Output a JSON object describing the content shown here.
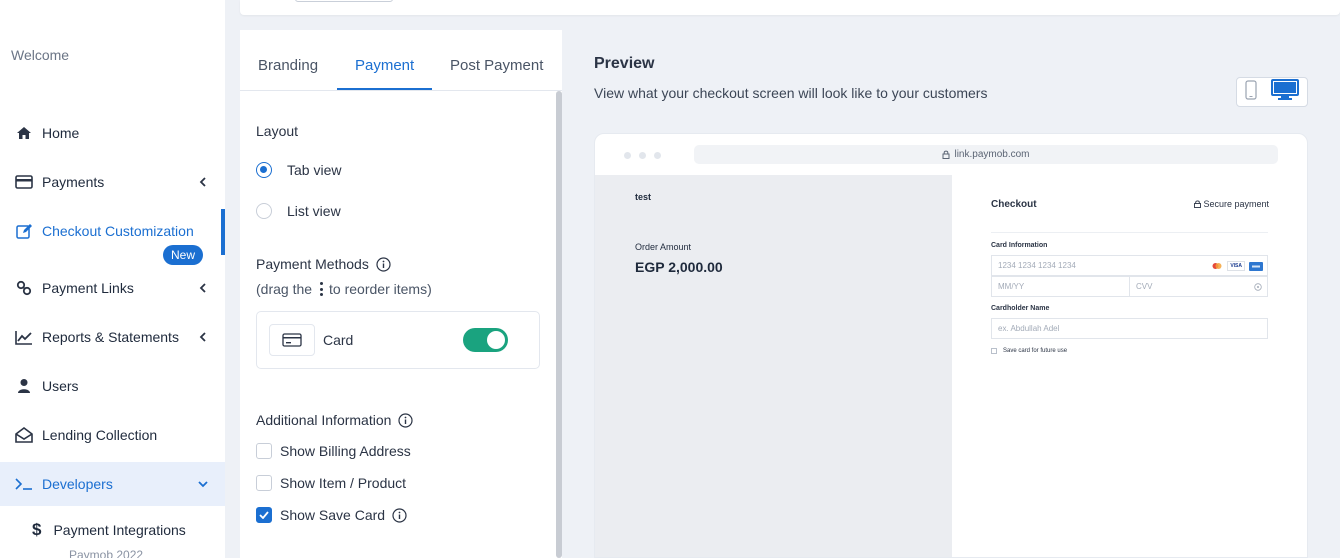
{
  "sidebar": {
    "welcome": "Welcome",
    "items": [
      {
        "label": "Home",
        "icon": "home-icon"
      },
      {
        "label": "Payments",
        "icon": "credit-card-icon"
      },
      {
        "label": "Checkout Customization",
        "icon": "edit-icon",
        "badge": "New"
      },
      {
        "label": "Payment Links",
        "icon": "link-icon"
      },
      {
        "label": "Reports & Statements",
        "icon": "chart-line-icon"
      },
      {
        "label": "Users",
        "icon": "user-icon"
      },
      {
        "label": "Lending Collection",
        "icon": "envelope-open-icon"
      },
      {
        "label": "Developers",
        "icon": "terminal-icon"
      }
    ],
    "sub_item": {
      "label": "Payment Integrations",
      "note": "Paymob 2022"
    }
  },
  "tabs": [
    "Branding",
    "Payment",
    "Post Payment"
  ],
  "layout": {
    "title": "Layout",
    "options": [
      "Tab view",
      "List view"
    ]
  },
  "payment_methods": {
    "title": "Payment Methods",
    "hint_before": "(drag the",
    "hint_after": "to reorder items)",
    "card_label": "Card"
  },
  "additional": {
    "title": "Additional Information",
    "options": [
      "Show Billing Address",
      "Show Item / Product",
      "Show Save Card"
    ]
  },
  "preview": {
    "title": "Preview",
    "description": "View what your checkout screen will look like to your customers",
    "url": "link.paymob.com",
    "merchant": "test",
    "order_label": "Order Amount",
    "order_amount": "EGP 2,000.00",
    "checkout_title": "Checkout",
    "secure": "Secure payment",
    "card_info_label": "Card Information",
    "card_number_placeholder": "1234 1234 1234 1234",
    "expiry_placeholder": "MM/YY",
    "cvv_placeholder": "CVV",
    "cardholder_label": "Cardholder Name",
    "cardholder_placeholder": "ex. Abdullah Adel",
    "save_card": "Save card for future use",
    "brands": [
      "VISA"
    ]
  },
  "colors": {
    "accent": "#1b6fd1",
    "toggle_on": "#1aa37f"
  }
}
